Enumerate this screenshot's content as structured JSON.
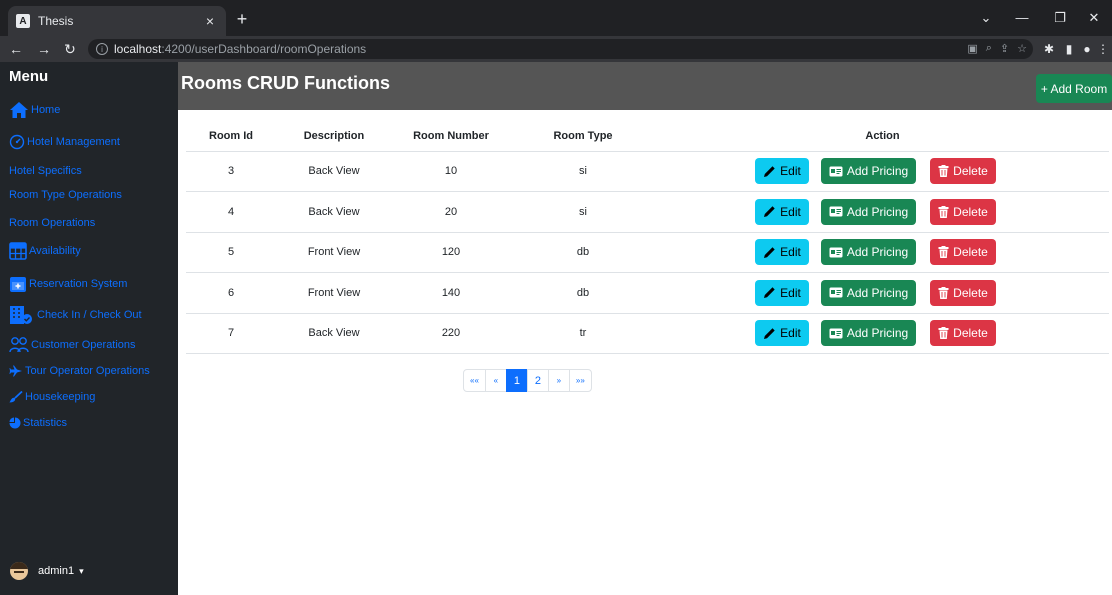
{
  "browser": {
    "tab_title": "Thesis",
    "tab_favicon": "A",
    "close_glyph": "×",
    "new_tab_glyph": "+",
    "url_host": "localhost",
    "url_path": ":4200/userDashboard/roomOperations"
  },
  "sidebar": {
    "title": "Menu",
    "items": [
      {
        "label": "Home",
        "icon": "house-icon"
      },
      {
        "label": "Hotel Management",
        "icon": "gauge-icon"
      },
      {
        "label": "Hotel Specifics",
        "icon": ""
      },
      {
        "label": "Room Type Operations",
        "icon": ""
      },
      {
        "label": "Room Operations",
        "icon": ""
      },
      {
        "label": "Availability",
        "icon": "table-icon"
      },
      {
        "label": "Reservation System",
        "icon": "calendar-plus-icon"
      },
      {
        "label": "Check In / Check Out",
        "icon": "building-check-icon"
      },
      {
        "label": "Customer Operations",
        "icon": "people-icon"
      },
      {
        "label": "Tour Operator Operations",
        "icon": "airplane-icon"
      },
      {
        "label": "Housekeeping",
        "icon": "brush-icon"
      },
      {
        "label": "Statistics",
        "icon": "pie-chart-icon"
      }
    ],
    "user": {
      "name": "admin1",
      "caret": "▾"
    }
  },
  "header": {
    "title": "Rooms CRUD Functions",
    "add_room_label": "+ Add Room"
  },
  "table": {
    "columns": [
      "Room Id",
      "Description",
      "Room Number",
      "Room Type",
      "Action"
    ],
    "rows": [
      {
        "id": "3",
        "description": "Back View",
        "number": "10",
        "type": "si"
      },
      {
        "id": "4",
        "description": "Back View",
        "number": "20",
        "type": "si"
      },
      {
        "id": "5",
        "description": "Front View",
        "number": "120",
        "type": "db"
      },
      {
        "id": "6",
        "description": "Front View",
        "number": "140",
        "type": "db"
      },
      {
        "id": "7",
        "description": "Back View",
        "number": "220",
        "type": "tr"
      }
    ],
    "actions": {
      "edit": "Edit",
      "pricing": "Add Pricing",
      "delete": "Delete"
    }
  },
  "pagination": {
    "first": "««",
    "prev": "«",
    "pages": [
      "1",
      "2"
    ],
    "active": "1",
    "next": "»",
    "last": "»»"
  },
  "colors": {
    "sidebar_bg": "#212529",
    "link": "#0d6efd",
    "header_bg": "#555555",
    "success": "#198754",
    "info": "#0dcaf0",
    "danger": "#dc3545"
  }
}
